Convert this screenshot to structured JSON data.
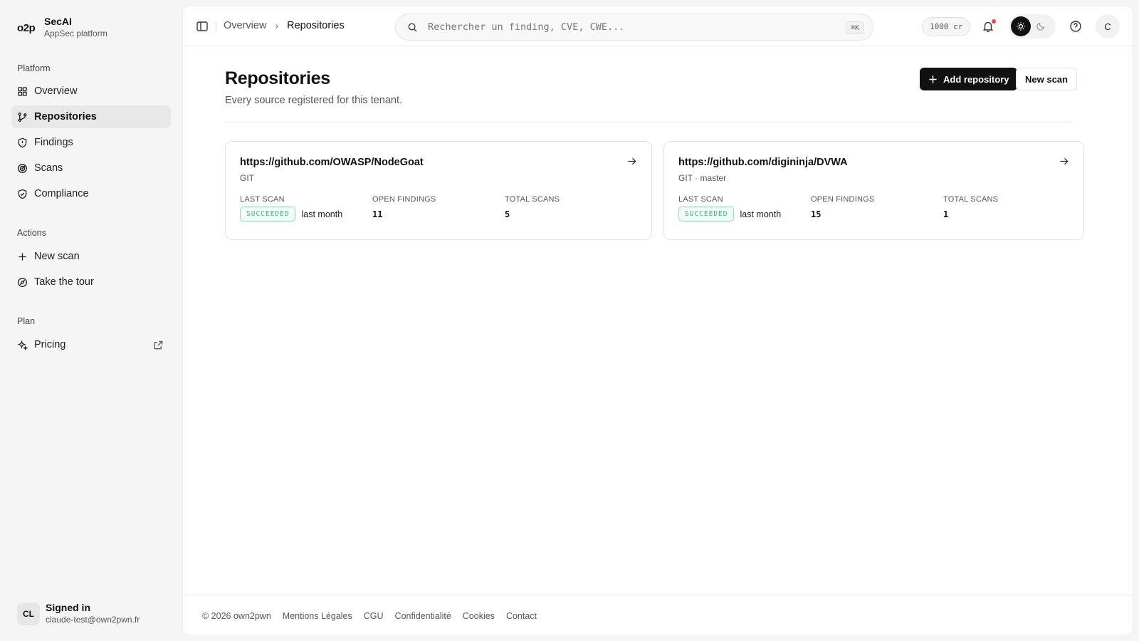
{
  "brand": {
    "logo": "o2p",
    "name": "SecAI",
    "subtitle": "AppSec platform"
  },
  "sidebar": {
    "sections": [
      {
        "label": "Platform"
      },
      {
        "label": "Actions"
      },
      {
        "label": "Plan"
      }
    ],
    "items": [
      {
        "label": "Overview",
        "icon": "grid-icon"
      },
      {
        "label": "Repositories",
        "icon": "git-branch-icon",
        "active": true
      },
      {
        "label": "Findings",
        "icon": "shield-alert-icon"
      },
      {
        "label": "Scans",
        "icon": "radar-icon"
      },
      {
        "label": "Compliance",
        "icon": "shield-check-icon"
      },
      {
        "label": "New scan",
        "icon": "plus-icon"
      },
      {
        "label": "Take the tour",
        "icon": "compass-icon"
      },
      {
        "label": "Pricing",
        "icon": "sparkles-icon",
        "external": true
      }
    ]
  },
  "user": {
    "initials": "CL",
    "title": "Signed in",
    "email": "claude-test@own2pwn.fr"
  },
  "topbar": {
    "breadcrumb": [
      "Overview",
      "Repositories"
    ],
    "search_placeholder": "Rechercher un finding, CVE, CWE...",
    "search_shortcut": "⌘K",
    "credits": "1000 cr",
    "account_initial": "C"
  },
  "page": {
    "title": "Repositories",
    "subtitle": "Every source registered for this tenant.",
    "add_button": "Add repository",
    "scan_button": "New scan"
  },
  "stat_labels": {
    "last_scan": "LAST SCAN",
    "open_findings": "OPEN FINDINGS",
    "total_scans": "TOTAL SCANS"
  },
  "repos": [
    {
      "url": "https://github.com/OWASP/NodeGoat",
      "type": "GIT",
      "status": "SUCCEEDED",
      "last_scan": "last month",
      "open_findings": "11",
      "total_scans": "5"
    },
    {
      "url": "https://github.com/digininja/DVWA",
      "type": "GIT · master",
      "status": "SUCCEEDED",
      "last_scan": "last month",
      "open_findings": "15",
      "total_scans": "1"
    }
  ],
  "footer": {
    "copyright": "© 2026 own2pwn",
    "links": [
      "Mentions Légales",
      "CGU",
      "Confidentialité",
      "Cookies",
      "Contact"
    ]
  },
  "colors": {
    "accent": "#111111",
    "success": "#37b77b",
    "notification": "#e5484d"
  }
}
